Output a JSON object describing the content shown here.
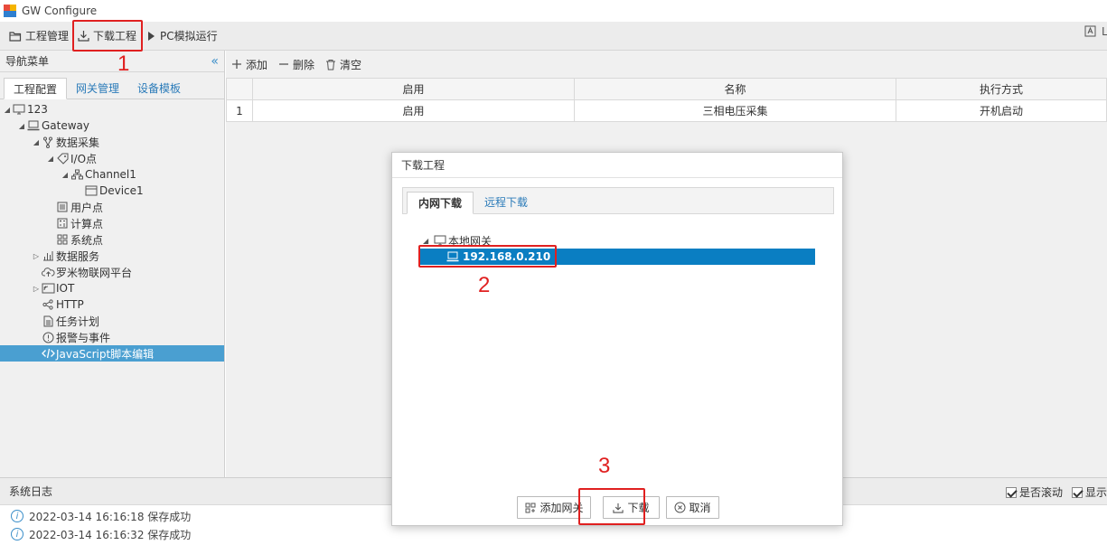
{
  "app": {
    "title": "GW Configure"
  },
  "toolbar": {
    "project_manage": "工程管理",
    "download_project": "下载工程",
    "pc_sim": "PC模拟运行",
    "right_label": "La"
  },
  "sidebar": {
    "title": "导航菜单",
    "collapse_glyph": "«",
    "tabs": [
      "工程配置",
      "网关管理",
      "设备模板"
    ],
    "tree": {
      "root": "123",
      "gateway": "Gateway",
      "data_collect": "数据采集",
      "io_point": "I/O点",
      "channel": "Channel1",
      "device": "Device1",
      "user_point": "用户点",
      "calc_point": "计算点",
      "sys_point": "系统点",
      "data_service": "数据服务",
      "lomi": "罗米物联网平台",
      "iot": "IOT",
      "http": "HTTP",
      "task": "任务计划",
      "alarm": "报警与事件",
      "js": "JavaScript脚本编辑"
    }
  },
  "main": {
    "tools": {
      "add": "添加",
      "delete": "删除",
      "clear": "清空"
    },
    "columns": [
      "启用",
      "名称",
      "执行方式"
    ],
    "rows": [
      {
        "num": "1",
        "enabled": "启用",
        "name": "三相电压采集",
        "mode": "开机启动"
      }
    ]
  },
  "dialog": {
    "title": "下载工程",
    "tabs": [
      "内网下载",
      "远程下载"
    ],
    "tree": {
      "root": "本地网关",
      "ip": "192.168.0.210"
    },
    "buttons": {
      "add_gateway": "添加网关",
      "download": "下载",
      "cancel": "取消"
    }
  },
  "status": {
    "title": "系统日志",
    "auto_scroll": "是否滚动",
    "show_label": "显示",
    "logs": [
      "2022-03-14 16:16:18 保存成功",
      "2022-03-14 16:16:32 保存成功"
    ]
  },
  "annotations": [
    "1",
    "2",
    "3"
  ],
  "colors": {
    "accent": "#2b7bb9",
    "selected": "#0a7ec2",
    "callout": "#e02020"
  }
}
